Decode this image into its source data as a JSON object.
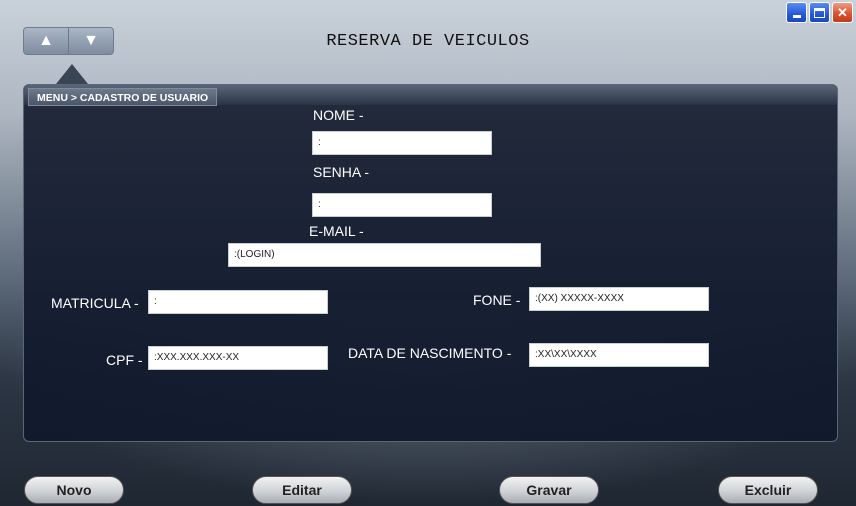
{
  "window": {
    "title": "RESERVA DE VEICULOS",
    "controls": {
      "minimize_icon": "minimize-icon",
      "maximize_icon": "maximize-icon",
      "close_icon": "close-icon",
      "close_glyph": "✕"
    }
  },
  "nav": {
    "up_glyph": "▲",
    "down_glyph": "▼"
  },
  "breadcrumb": "MENU > CADASTRO DE USUARIO",
  "form": {
    "nome": {
      "label": "NOME -",
      "value": ":"
    },
    "senha": {
      "label": "SENHA -",
      "value": ":"
    },
    "email": {
      "label": "E-MAIL -",
      "value": ":(LOGIN)"
    },
    "matricula": {
      "label": "MATRICULA -",
      "value": ":"
    },
    "fone": {
      "label": "FONE -",
      "value": ":(XX) XXXXX-XXXX"
    },
    "cpf": {
      "label": "CPF -",
      "value": ":XXX.XXX.XXX-XX"
    },
    "nascimento": {
      "label": "DATA DE NASCIMENTO -",
      "value": ":XX\\XX\\XXXX"
    }
  },
  "buttons": {
    "novo": "Novo",
    "editar": "Editar",
    "gravar": "Gravar",
    "excluir": "Excluir"
  }
}
